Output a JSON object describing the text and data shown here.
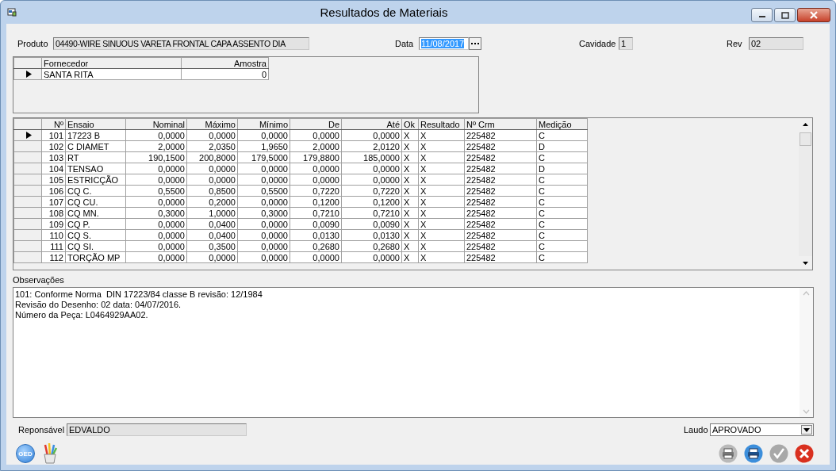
{
  "window": {
    "title": "Resultados de Materiais"
  },
  "header": {
    "produto": {
      "label": "Produto",
      "value": "04490-WIRE SINUOUS VARETA FRONTAL CAPA ASSENTO DIA"
    },
    "data": {
      "label": "Data",
      "value": "11/08/2017",
      "text_selected": true
    },
    "cavidade": {
      "label": "Cavidade",
      "value": "1"
    },
    "rev": {
      "label": "Rev",
      "value": "02"
    }
  },
  "suppliers": {
    "columns": [
      {
        "label": "Fornecedor",
        "kind": "text"
      },
      {
        "label": "Amostra",
        "kind": "number"
      }
    ],
    "rows": [
      {
        "current": true,
        "cells": [
          "SANTA RITA",
          "0"
        ]
      }
    ]
  },
  "tests": {
    "columns": [
      {
        "label": "Nº",
        "kind": "number"
      },
      {
        "label": "Ensaio",
        "kind": "text"
      },
      {
        "label": "Nominal",
        "kind": "number"
      },
      {
        "label": "Máximo",
        "kind": "number"
      },
      {
        "label": "Mínimo",
        "kind": "number"
      },
      {
        "label": "De",
        "kind": "number"
      },
      {
        "label": "Até",
        "kind": "number"
      },
      {
        "label": "Ok",
        "kind": "text"
      },
      {
        "label": "Resultado",
        "kind": "text"
      },
      {
        "label": "Nº Crm",
        "kind": "text"
      },
      {
        "label": "Medição",
        "kind": "text"
      }
    ],
    "rows": [
      {
        "current": true,
        "cells": [
          "101",
          "17223 B",
          "0,0000",
          "0,0000",
          "0,0000",
          "0,0000",
          "0,0000",
          "X",
          "X",
          "225482",
          "C"
        ]
      },
      {
        "current": false,
        "cells": [
          "102",
          "C DIAMET",
          "2,0000",
          "2,0350",
          "1,9650",
          "2,0000",
          "2,0120",
          "X",
          "X",
          "225482",
          "D"
        ]
      },
      {
        "current": false,
        "cells": [
          "103",
          "RT",
          "190,1500",
          "200,8000",
          "179,5000",
          "179,8800",
          "185,0000",
          "X",
          "X",
          "225482",
          "C"
        ]
      },
      {
        "current": false,
        "cells": [
          "104",
          "TENSAO",
          "0,0000",
          "0,0000",
          "0,0000",
          "0,0000",
          "0,0000",
          "X",
          "X",
          "225482",
          "D"
        ]
      },
      {
        "current": false,
        "cells": [
          "105",
          "ESTRICÇÃO",
          "0,0000",
          "0,0000",
          "0,0000",
          "0,0000",
          "0,0000",
          "X",
          "X",
          "225482",
          "C"
        ]
      },
      {
        "current": false,
        "cells": [
          "106",
          "CQ C.",
          "0,5500",
          "0,8500",
          "0,5500",
          "0,7220",
          "0,7220",
          "X",
          "X",
          "225482",
          "C"
        ]
      },
      {
        "current": false,
        "cells": [
          "107",
          "CQ CU.",
          "0,0000",
          "0,2000",
          "0,0000",
          "0,1200",
          "0,1200",
          "X",
          "X",
          "225482",
          "C"
        ]
      },
      {
        "current": false,
        "cells": [
          "108",
          "CQ MN.",
          "0,3000",
          "1,0000",
          "0,3000",
          "0,7210",
          "0,7210",
          "X",
          "X",
          "225482",
          "C"
        ]
      },
      {
        "current": false,
        "cells": [
          "109",
          "CQ P.",
          "0,0000",
          "0,0400",
          "0,0000",
          "0,0090",
          "0,0090",
          "X",
          "X",
          "225482",
          "C"
        ]
      },
      {
        "current": false,
        "cells": [
          "110",
          "CQ S.",
          "0,0000",
          "0,0400",
          "0,0000",
          "0,0130",
          "0,0130",
          "X",
          "X",
          "225482",
          "C"
        ]
      },
      {
        "current": false,
        "cells": [
          "111",
          "CQ SI.",
          "0,0000",
          "0,3500",
          "0,0000",
          "0,2680",
          "0,2680",
          "X",
          "X",
          "225482",
          "C"
        ]
      },
      {
        "current": false,
        "cells": [
          "112",
          "TORÇÃO MP",
          "0,0000",
          "0,0000",
          "0,0000",
          "0,0000",
          "0,0000",
          "X",
          "X",
          "225482",
          "C"
        ]
      }
    ]
  },
  "observations": {
    "label": "Observações",
    "value": "101: Conforme Norma  DIN 17223/84 classe B revisão: 12/1984\nRevisão do Desenho: 02 data: 04/07/2016.\nNúmero da Peça: L0464929AA02."
  },
  "responsavel": {
    "label": "Reponsável",
    "value": "EDVALDO"
  },
  "laudo": {
    "label": "Laudo",
    "value": "APROVADO"
  },
  "toolbar": {
    "left": [
      {
        "kind": "ged",
        "label": "GED"
      },
      {
        "kind": "pencils"
      }
    ],
    "right": [
      {
        "kind": "print-grey"
      },
      {
        "kind": "print-blue"
      },
      {
        "kind": "check"
      },
      {
        "kind": "cancel"
      }
    ]
  }
}
